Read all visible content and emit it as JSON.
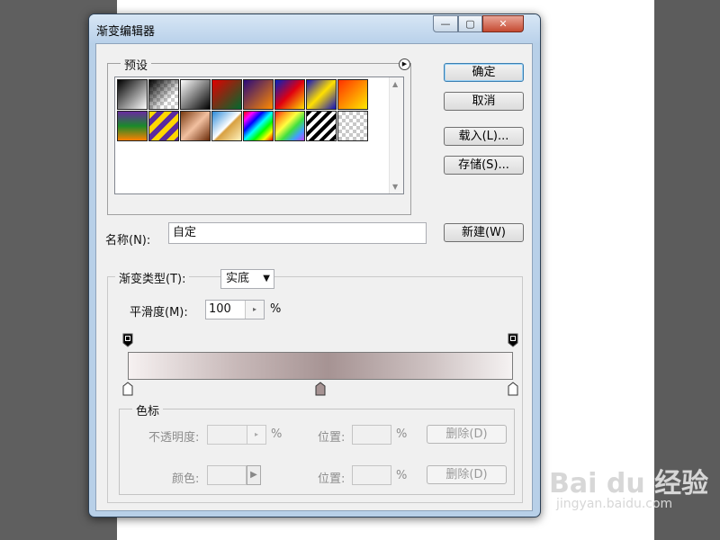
{
  "window": {
    "title": "渐变编辑器",
    "controls": {
      "minimize": "—",
      "maximize": "▢",
      "close": "✕"
    }
  },
  "presets": {
    "legend": "预设",
    "swatches": [
      "black-white",
      "transparent-checker",
      "white-black",
      "red-green",
      "violet-orange",
      "blue-red-yellow",
      "blue-yellow-blue",
      "orange-yellow",
      "purple-green-orange",
      "yellow-violet-stripes",
      "copper",
      "chrome",
      "spectrum",
      "rainbow-transparent",
      "diagonal-stripes",
      "transparent"
    ]
  },
  "buttons": {
    "ok": "确定",
    "cancel": "取消",
    "load": "载入(L)...",
    "save": "存储(S)...",
    "new": "新建(W)"
  },
  "name": {
    "label": "名称(N):",
    "value": "自定"
  },
  "gradient_type": {
    "label": "渐变类型(T):",
    "value": "实底"
  },
  "smoothness": {
    "label": "平滑度(M):",
    "value": "100",
    "unit": "%"
  },
  "gradient": {
    "colors": [
      "#f6f1f1",
      "#c8b9b9",
      "#a69393",
      "#cdc1c1",
      "#f5f2f2"
    ],
    "opacity_stops": [
      0,
      1
    ],
    "color_stops": [
      0,
      0.5,
      1
    ]
  },
  "stops": {
    "legend": "色标",
    "opacity_label": "不透明度:",
    "opacity_unit": "%",
    "position_label": "位置:",
    "position_unit": "%",
    "delete": "删除(D)",
    "color_label": "颜色:",
    "position_label2": "位置:",
    "position_unit2": "%",
    "delete2": "删除(D)"
  },
  "watermark": {
    "main": "Bai du 经验",
    "sub": "jingyan.baidu.com"
  }
}
